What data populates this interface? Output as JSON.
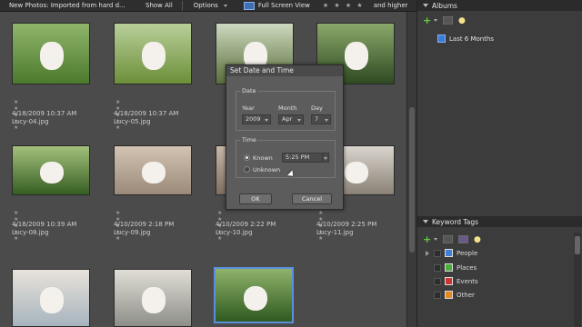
{
  "toolbar": {
    "path": "New Photos: Imported from hard d...",
    "show_all": "Show All",
    "options": "Options",
    "full_screen": "Full Screen View",
    "stars": "★ ★ ★ ★",
    "higher": "and higher"
  },
  "photos": [
    {
      "date": "4/18/2009 10:37 AM",
      "file": "Lucy-04.jpg",
      "stars": "★ ★ ★ ★ ★",
      "colors": [
        "#4c7a2c",
        "#8fb56a"
      ]
    },
    {
      "date": "4/18/2009 10:37 AM",
      "file": "Lucy-05.jpg",
      "stars": "★ ★ ★ ★ ★",
      "colors": [
        "#6c8f39",
        "#b9cf9a"
      ]
    },
    {
      "date": "",
      "file": "",
      "stars": "",
      "colors": [
        "#5a6e3a",
        "#cdd9c0"
      ]
    },
    {
      "date": "",
      "file": "",
      "stars": "",
      "colors": [
        "#2f4a22",
        "#8aa86a"
      ]
    },
    {
      "date": "4/18/2009 10:39 AM",
      "file": "Lucy-08.jpg",
      "stars": "★ ★ ★ ★ ★",
      "colors": [
        "#365e22",
        "#a3c07c"
      ]
    },
    {
      "date": "4/10/2009 2:18 PM",
      "file": "Lucy-09.jpg",
      "stars": "★ ★ ★ ★ ★",
      "colors": [
        "#9b8a78",
        "#d2c3b3"
      ]
    },
    {
      "date": "4/10/2009 2:22 PM",
      "file": "Lucy-10.jpg",
      "stars": "★ ★ ★ ★ ★",
      "colors": [
        "#7f6e5e",
        "#c7b8a8"
      ]
    },
    {
      "date": "4/10/2009 2:25 PM",
      "file": "Lucy-11.jpg",
      "stars": "★ ★ ★ ★ ★",
      "colors": [
        "#8a8276",
        "#d9d4cd"
      ]
    },
    {
      "date": "",
      "file": "",
      "stars": "",
      "colors": [
        "#a7b4be",
        "#e8e2da"
      ]
    },
    {
      "date": "",
      "file": "",
      "stars": "",
      "colors": [
        "#8d8f88",
        "#e0ddd6"
      ]
    },
    {
      "date": "",
      "file": "",
      "stars": "",
      "colors": [
        "#2f5a1f",
        "#8fb26b"
      ]
    }
  ],
  "panel": {
    "albums_title": "Albums",
    "album_item": "Last 6 Months",
    "keywords_title": "Keyword Tags",
    "tags": [
      {
        "label": "People",
        "color": "#3f7fd6"
      },
      {
        "label": "Places",
        "color": "#4cae3a"
      },
      {
        "label": "Events",
        "color": "#cc3434"
      },
      {
        "label": "Other",
        "color": "#e58a1f"
      }
    ]
  },
  "dialog": {
    "title": "Set Date and Time",
    "date_group": "Date",
    "year_label": "Year",
    "month_label": "Month",
    "day_label": "Day",
    "year": "2009",
    "month": "Apr",
    "day": "7",
    "time_group": "Time",
    "known": "Known",
    "time_value": "5:25 PM",
    "unknown": "Unknown",
    "ok": "OK",
    "cancel": "Cancel"
  }
}
